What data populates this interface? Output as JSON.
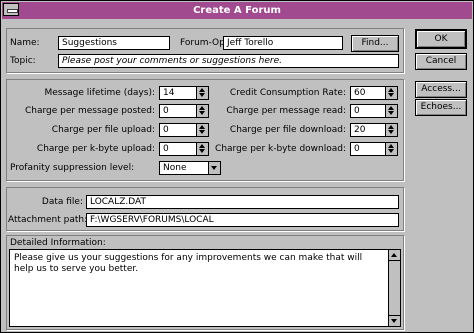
{
  "window": {
    "title": "Create A Forum"
  },
  "top": {
    "name_label": "Name:",
    "name_value": "Suggestions",
    "sysop_label": "Forum-Op:",
    "sysop_value": "Jeff Torello",
    "find_label": "Find...",
    "topic_label": "Topic:",
    "topic_value": "Please post your comments or suggestions here."
  },
  "buttons": {
    "ok": "OK",
    "cancel": "Cancel",
    "access": "Access...",
    "echoes": "Echoes..."
  },
  "settings": {
    "left": [
      {
        "label": "Message lifetime (days):",
        "value": "14"
      },
      {
        "label": "Charge per message posted:",
        "value": "0"
      },
      {
        "label": "Charge per file upload:",
        "value": "0"
      },
      {
        "label": "Charge per k-byte upload:",
        "value": "0"
      }
    ],
    "right": [
      {
        "label": "Credit Consumption Rate:",
        "value": "60"
      },
      {
        "label": "Charge per message read:",
        "value": "0"
      },
      {
        "label": "Charge per file download:",
        "value": "20"
      },
      {
        "label": "Charge per k-byte download:",
        "value": "0"
      }
    ],
    "profanity_label": "Profanity suppression level:",
    "profanity_value": "None"
  },
  "files": {
    "data_file_label": "Data file:",
    "data_file_value": "LOCALZ.DAT",
    "attach_label": "Attachment path:",
    "attach_value": "F:\\WGSERV\\FORUMS\\LOCAL"
  },
  "detail": {
    "label": "Detailed Information:",
    "text": "Please give us your suggestions for any improvements we can make that will help us to serve you better."
  }
}
